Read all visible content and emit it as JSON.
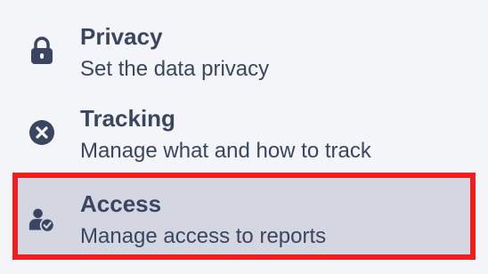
{
  "menu": {
    "items": [
      {
        "title": "Privacy",
        "subtitle": "Set the data privacy",
        "icon": "lock-icon"
      },
      {
        "title": "Tracking",
        "subtitle": "Manage what and how to track",
        "icon": "x-circle-icon"
      },
      {
        "title": "Access",
        "subtitle": "Manage access to reports",
        "icon": "user-check-icon",
        "selected": true
      }
    ]
  },
  "colors": {
    "background": "#f4f5f8",
    "text": "#3a4660",
    "selected_background": "#d4d7e2",
    "highlight_border": "#f01e1e"
  }
}
